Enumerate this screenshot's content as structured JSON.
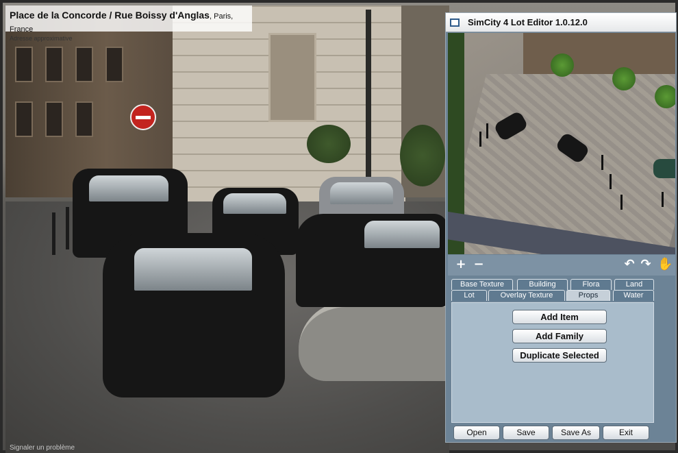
{
  "street_view": {
    "title": "Place de la Concorde / Rue Boissy d'Anglas",
    "city": "Paris, France",
    "subtitle": "Adresse approximative",
    "report_link": "Signaler un problème",
    "zoom": {
      "in_icon": "+",
      "out_icon": "−"
    }
  },
  "editor": {
    "title": "SimCity 4 Lot Editor 1.0.12.0",
    "toolbar": {
      "zoom_in_icon": "+",
      "zoom_out_icon": "−",
      "rotate_left_icon": "↶",
      "rotate_right_icon": "↷",
      "hand_icon": "✋"
    },
    "tabs_row1": [
      "Base Texture",
      "Building",
      "Flora",
      "Land"
    ],
    "tabs_row2": [
      "Lot",
      "Overlay Texture",
      "Props",
      "Water"
    ],
    "active_tab": "Props",
    "panel_buttons": [
      "Add Item",
      "Add Family",
      "Duplicate Selected"
    ],
    "bottom_buttons": [
      "Open",
      "Save",
      "Save As",
      "Exit"
    ]
  },
  "colors": {
    "editor_bg": "#6c8396",
    "panel_bg": "#a9bccb",
    "tab_bg": "#5f7a90",
    "tab_active": "#c6d0d9"
  }
}
